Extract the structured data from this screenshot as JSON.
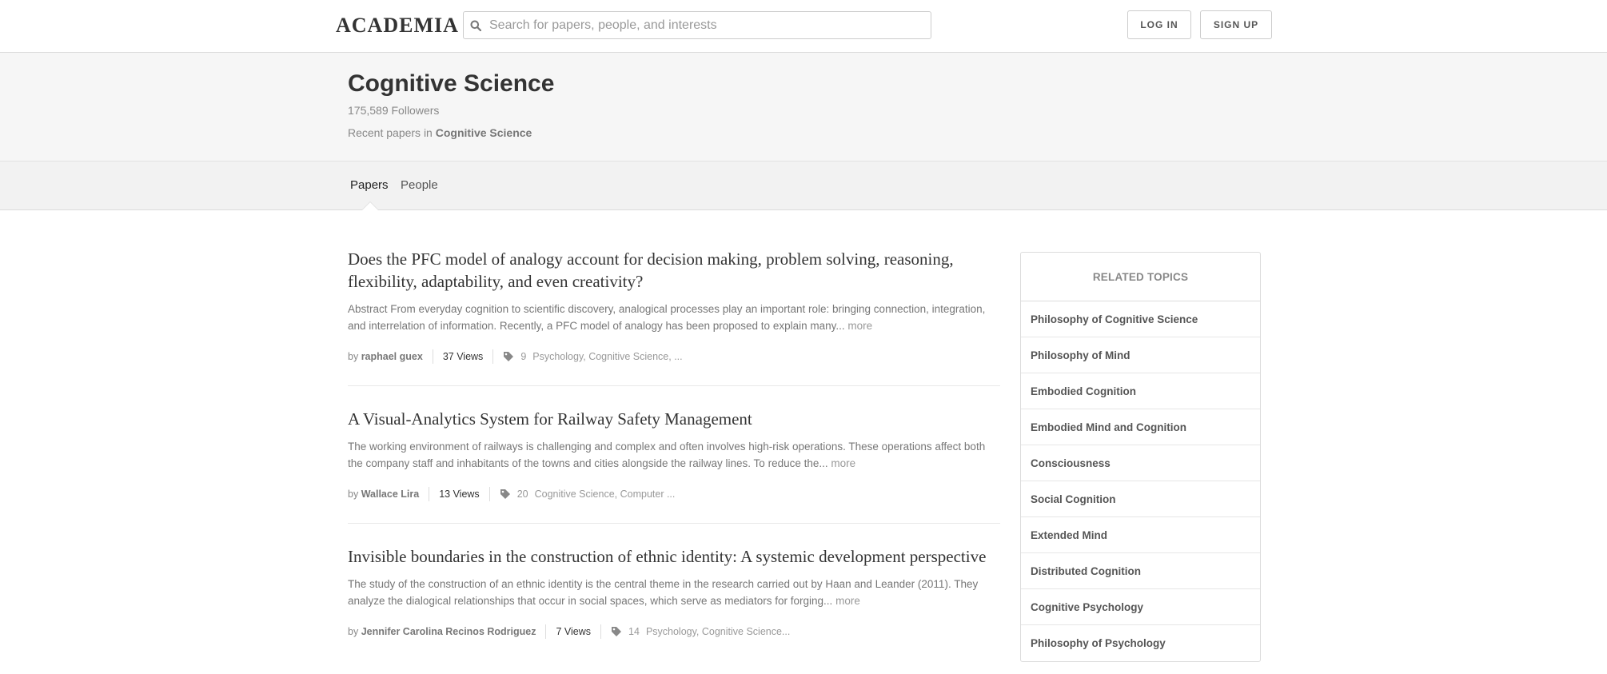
{
  "topbar": {
    "logo": "ACADEMIA",
    "search_placeholder": "Search for papers, people, and interests",
    "login_label": "LOG IN",
    "signup_label": "SIGN UP"
  },
  "hero": {
    "title": "Cognitive Science",
    "followers": "175,589 Followers",
    "recent_prefix": "Recent papers in ",
    "recent_topic": "Cognitive Science"
  },
  "tabs": [
    {
      "label": "Papers",
      "active": true
    },
    {
      "label": "People",
      "active": false
    }
  ],
  "papers": [
    {
      "title": "Does the PFC model of analogy account for decision making, problem solving, reasoning, flexibility, adaptability, and even creativity?",
      "abstract": "Abstract From everyday cognition to scientific discovery, analogical processes play an important role: bringing connection, integration, and interrelation of information. Recently, a PFC model of analogy has been proposed to explain many...",
      "more": "more",
      "by": "by ",
      "author": "raphael guex",
      "views": "37 Views",
      "tag_count": "9",
      "tags": "Psychology, Cognitive Science, ..."
    },
    {
      "title": "A Visual-Analytics System for Railway Safety Management",
      "abstract": "The working environment of railways is challenging and complex and often involves high-risk operations. These operations affect both the company staff and inhabitants of the towns and cities alongside the railway lines. To reduce the...",
      "more": "more",
      "by": "by ",
      "author": "Wallace Lira",
      "views": "13 Views",
      "tag_count": "20",
      "tags": "Cognitive Science, Computer ..."
    },
    {
      "title": "Invisible boundaries in the construction of ethnic identity: A systemic development perspective",
      "abstract": "The study of the construction of an ethnic identity is the central theme in the research carried out by Haan and Leander (2011). They analyze the dialogical relationships that occur in social spaces, which serve as mediators for forging...",
      "more": "more",
      "by": "by ",
      "author": "Jennifer Carolina Recinos Rodriguez",
      "views": "7 Views",
      "tag_count": "14",
      "tags": "Psychology, Cognitive Science..."
    }
  ],
  "related": {
    "heading": "RELATED TOPICS",
    "topics": [
      "Philosophy of Cognitive Science",
      "Philosophy of Mind",
      "Embodied Cognition",
      "Embodied Mind and Cognition",
      "Consciousness",
      "Social Cognition",
      "Extended Mind",
      "Distributed Cognition",
      "Cognitive Psychology",
      "Philosophy of Psychology"
    ]
  },
  "icons": {
    "search": "search-icon",
    "tag": "tag-icon"
  }
}
